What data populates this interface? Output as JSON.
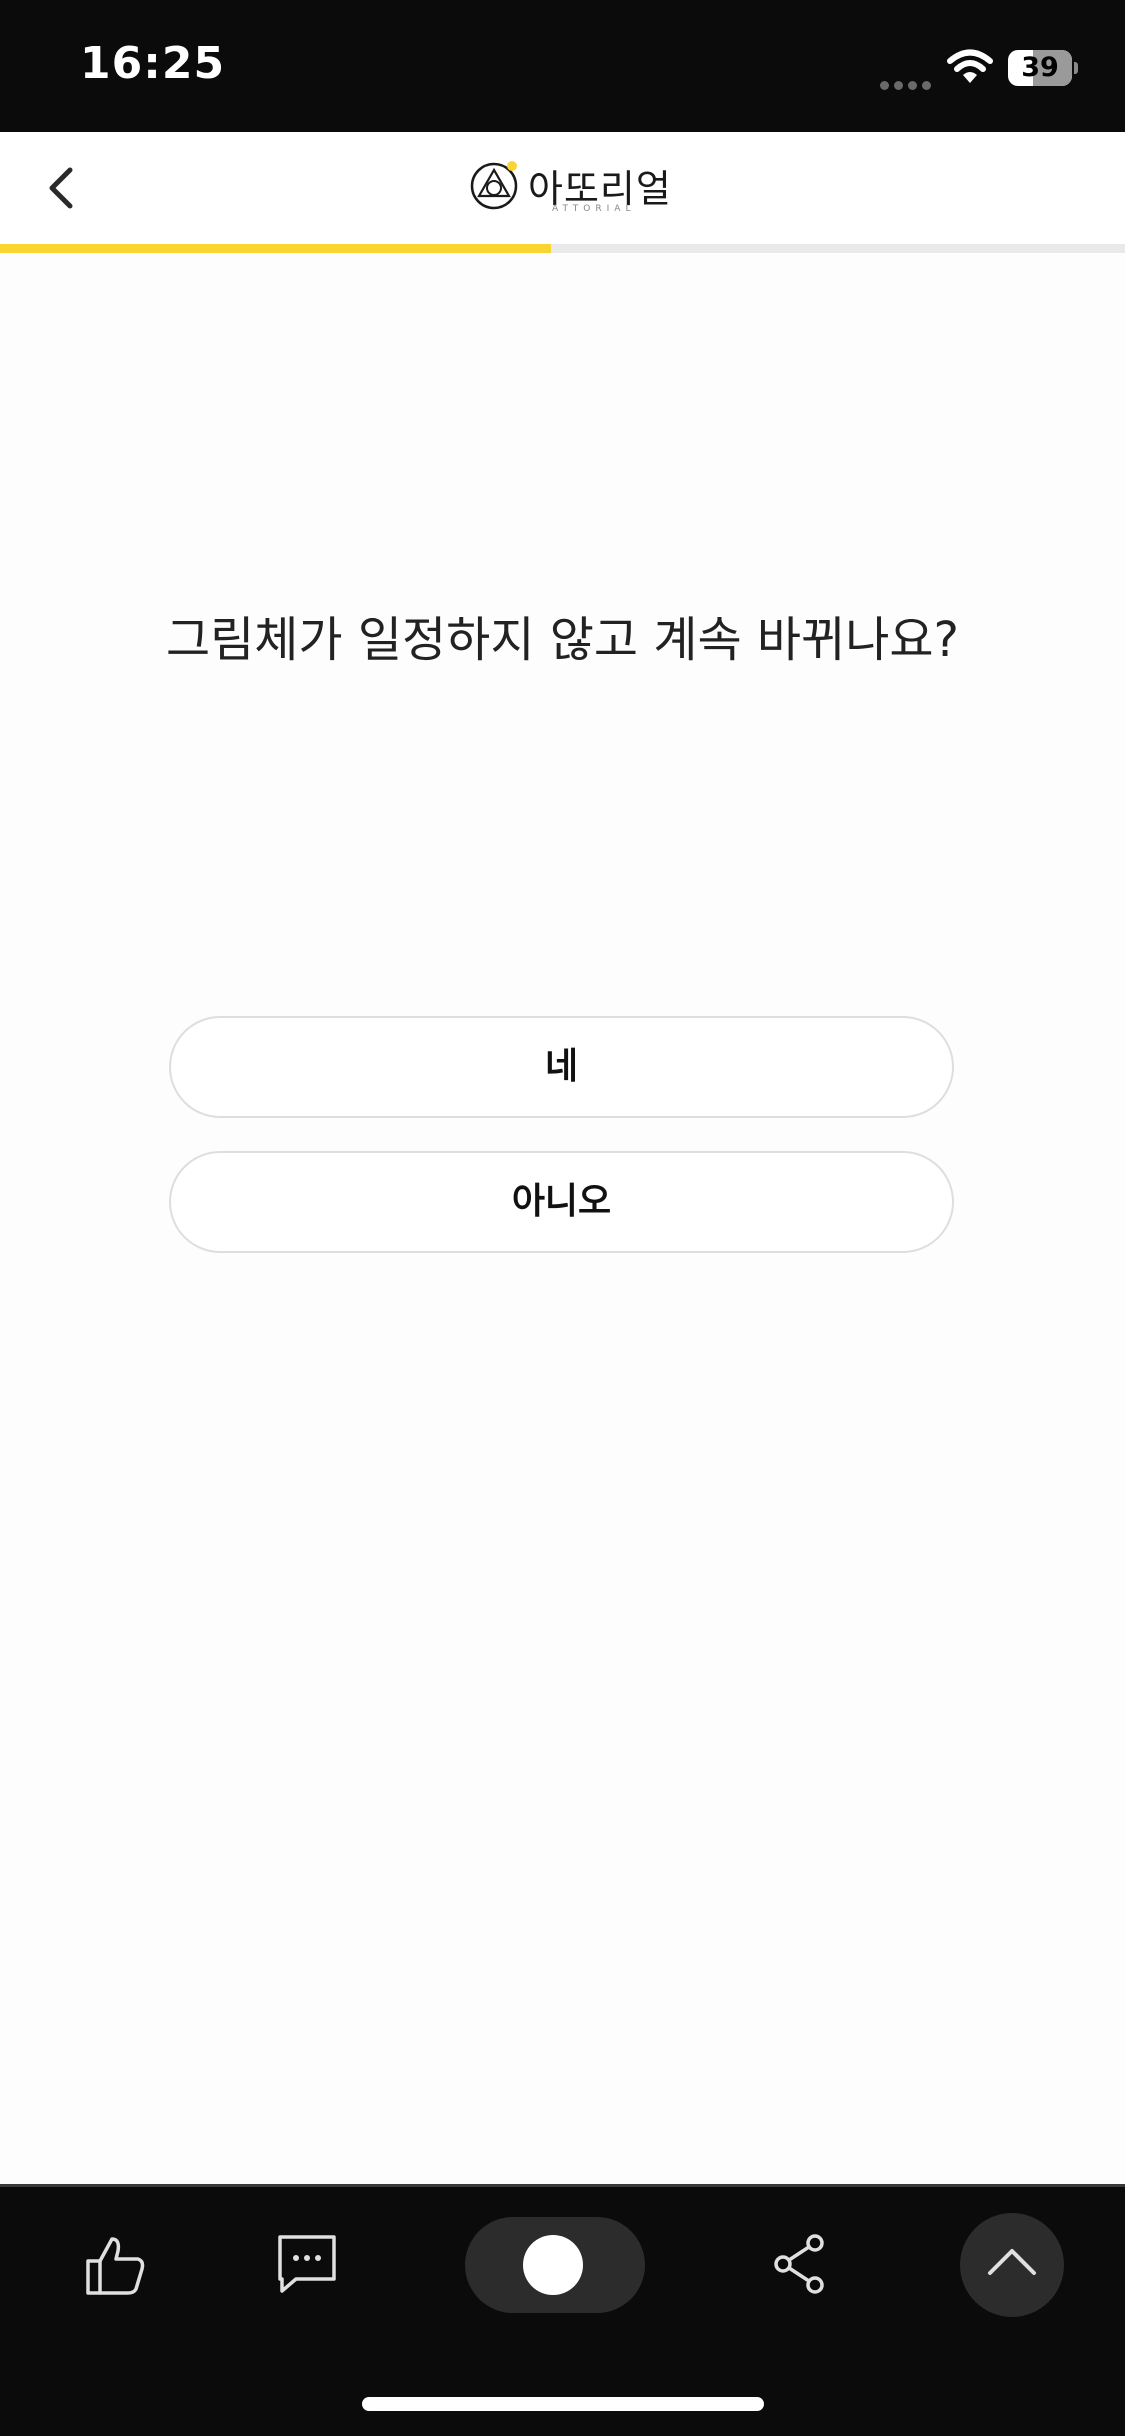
{
  "status_bar": {
    "time": "16:25",
    "battery_level": "39",
    "battery_charge_percent": 39,
    "icons": [
      "signal-dots-icon",
      "wifi-icon",
      "battery-icon"
    ]
  },
  "header": {
    "back_icon": "chevron-left-icon",
    "logo_text": "아또리얼",
    "logo_subtext": "ATTORIAL"
  },
  "progress": {
    "percent": 49,
    "fill_color": "#fad531",
    "track_color": "#e9e9e9"
  },
  "question": {
    "text": "그림체가 일정하지 않고 계속 바뀌나요?"
  },
  "answers": {
    "yes_label": "네",
    "no_label": "아니오"
  },
  "bottom_bar": {
    "icons": [
      "thumbs-up-icon",
      "comment-icon",
      "toggle-switch",
      "share-icon",
      "chevron-up-icon"
    ],
    "toggle_state": "on"
  },
  "colors": {
    "accent": "#fad531",
    "bar_background": "#0b0b0b",
    "page_background": "#fdfdfd"
  }
}
